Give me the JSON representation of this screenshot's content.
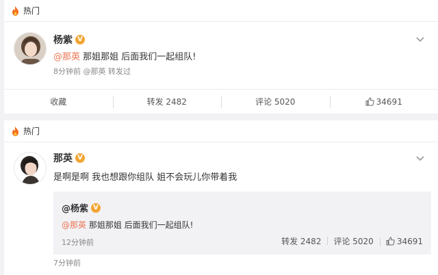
{
  "posts": [
    {
      "hot_label": "热门",
      "author": "杨紫",
      "badge": "V",
      "mention": "@那英",
      "text": " 那姐那姐 后面我们一起组队!",
      "meta": "8分钟前 @那英 转发过",
      "actions": {
        "favorite": "收藏",
        "forward": "转发 2482",
        "comment": "评论 5020",
        "like": "34691"
      }
    },
    {
      "hot_label": "热门",
      "author": "那英",
      "badge": "V",
      "text": "是啊是啊 我也想跟你组队 姐不会玩儿你带着我",
      "meta": "7分钟前",
      "repost": {
        "author": "@杨紫",
        "badge": "V",
        "mention": "@那英",
        "text": " 那姐那姐 后面我们一起组队!",
        "time": "12分钟前",
        "forward": "转发 2482",
        "comment": "评论 5020",
        "like": "34691"
      }
    }
  ],
  "colors": {
    "accent": "#eb7350",
    "badge": "#f3a533",
    "page_bg": "#f2f2f5"
  },
  "icons": [
    "fire-icon",
    "chevron-down-icon",
    "thumbs-up-icon",
    "avatar"
  ]
}
